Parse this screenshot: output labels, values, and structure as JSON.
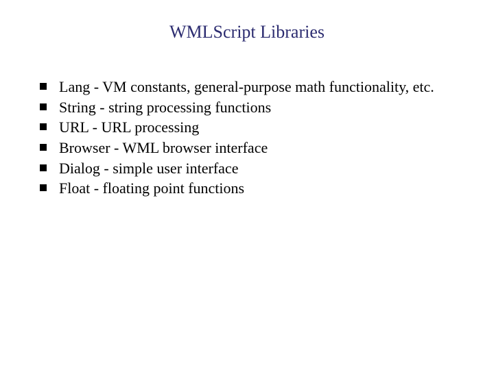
{
  "title": "WMLScript Libraries",
  "bullets": [
    "Lang - VM constants, general-purpose math functionality, etc.",
    "String - string processing functions",
    "URL - URL processing",
    "Browser - WML browser interface",
    "Dialog - simple user interface",
    "Float - floating point functions"
  ]
}
